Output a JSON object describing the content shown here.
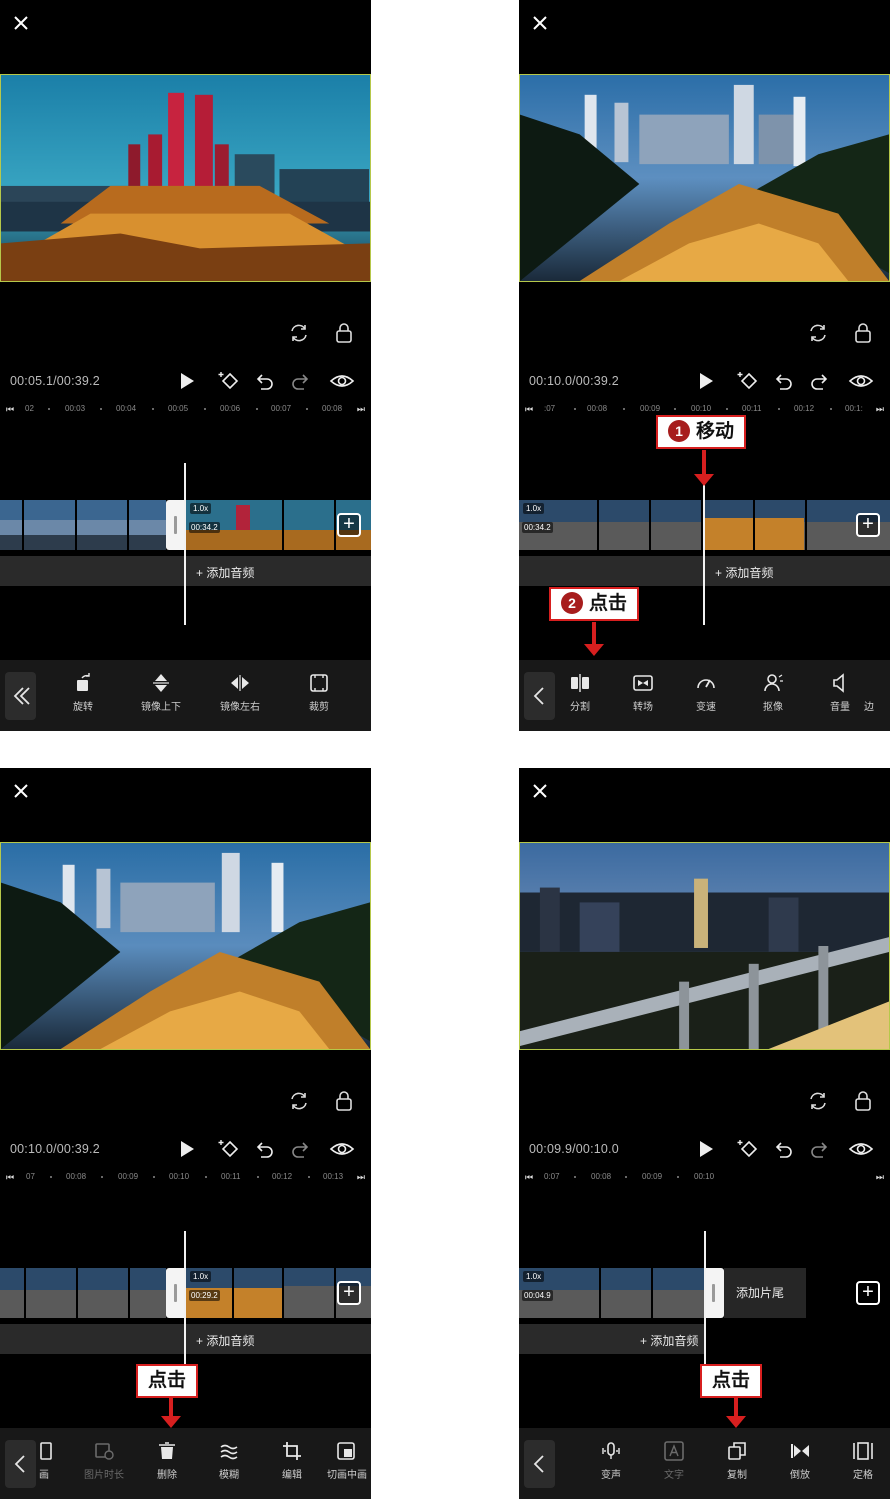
{
  "panels": [
    {
      "time": "00:05.1/00:39.2",
      "ruler": [
        "02",
        "00:03",
        "00:04",
        "00:05",
        "00:06",
        "00:07",
        "00:08"
      ],
      "clip": {
        "speed": "1.0x",
        "duration": "00:34.2"
      },
      "audio_label": "+ 添加音频",
      "tools": [
        {
          "icon": "rotate-icon",
          "label": "旋转"
        },
        {
          "icon": "flip-vertical-icon",
          "label": "镜像上下"
        },
        {
          "icon": "flip-horizontal-icon",
          "label": "镜像左右"
        },
        {
          "icon": "crop-icon",
          "label": "裁剪"
        }
      ]
    },
    {
      "time": "00:10.0/00:39.2",
      "ruler": [
        ":07",
        "00:08",
        "00:09",
        "00:10",
        "00:11",
        "00:12",
        "00:1:"
      ],
      "clip": {
        "speed": "1.0x",
        "duration": "00:34.2"
      },
      "audio_label": "+ 添加音频",
      "tools": [
        {
          "icon": "split-icon",
          "label": "分割"
        },
        {
          "icon": "transition-icon",
          "label": "转场"
        },
        {
          "icon": "speed-icon",
          "label": "变速"
        },
        {
          "icon": "cutout-icon",
          "label": "抠像"
        },
        {
          "icon": "volume-icon",
          "label": "音量"
        },
        {
          "icon": "more-icon",
          "label": "边"
        }
      ],
      "callouts": [
        {
          "num": "1",
          "text": "移动"
        },
        {
          "num": "2",
          "text": "点击"
        }
      ]
    },
    {
      "time": "00:10.0/00:39.2",
      "ruler": [
        "07",
        "00:08",
        "00:09",
        "00:10",
        "00:11",
        "00:12",
        "00:13"
      ],
      "clip": {
        "speed": "1.0x",
        "duration": "00:29.2"
      },
      "audio_label": "+ 添加音频",
      "tools": [
        {
          "icon": "frame-icon",
          "label": "画"
        },
        {
          "icon": "image-duration-icon",
          "label": "图片时长"
        },
        {
          "icon": "delete-icon",
          "label": "删除"
        },
        {
          "icon": "blur-icon",
          "label": "模糊"
        },
        {
          "icon": "edit-icon",
          "label": "编辑"
        },
        {
          "icon": "cut-in-icon",
          "label": "切画中画"
        }
      ],
      "callouts": [
        {
          "text": "点击"
        }
      ]
    },
    {
      "time": "00:09.9/00:10.0",
      "ruler": [
        "0:07",
        "00:08",
        "00:09",
        "00:10"
      ],
      "clip": {
        "speed": "1.0x",
        "duration": "00:04.9"
      },
      "audio_label": "+ 添加音频",
      "add_tail": "添加片尾",
      "tools": [
        {
          "icon": "voice-change-icon",
          "label": "变声"
        },
        {
          "icon": "text-icon",
          "label": "文字"
        },
        {
          "icon": "copy-icon",
          "label": "复制"
        },
        {
          "icon": "reverse-icon",
          "label": "倒放"
        },
        {
          "icon": "freeze-icon",
          "label": "定格"
        }
      ],
      "callouts": [
        {
          "text": "点击"
        }
      ]
    }
  ]
}
